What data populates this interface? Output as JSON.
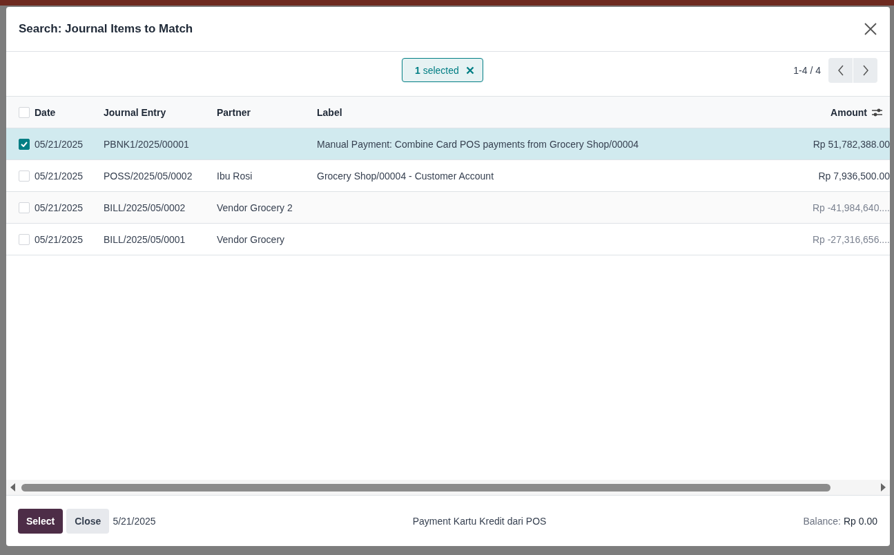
{
  "dialog": {
    "title": "Search: Journal Items to Match"
  },
  "selection": {
    "count": "1",
    "text": "selected"
  },
  "pager": {
    "range": "1-4 / 4"
  },
  "table": {
    "all_selected": false,
    "columns": [
      "Date",
      "Journal Entry",
      "Partner",
      "Label",
      "Amount"
    ],
    "rows": [
      {
        "selected": true,
        "date": "05/21/2025",
        "entry": "PBNK1/2025/00001",
        "partner": "",
        "label": "Manual Payment: Combine Card POS payments from Grocery Shop/00004",
        "amount": "Rp 51,782,388.00",
        "muted": false
      },
      {
        "selected": false,
        "date": "05/21/2025",
        "entry": "POSS/2025/05/0002",
        "partner": "Ibu Rosi",
        "label": "Grocery Shop/00004 - Customer Account",
        "amount": "Rp 7,936,500.00",
        "muted": false
      },
      {
        "selected": false,
        "date": "05/21/2025",
        "entry": "BILL/2025/05/0002",
        "partner": "Vendor Grocery 2",
        "label": "",
        "amount": "Rp -41,984,640....",
        "muted": true
      },
      {
        "selected": false,
        "date": "05/21/2025",
        "entry": "BILL/2025/05/0001",
        "partner": "Vendor Grocery",
        "label": "",
        "amount": "Rp -27,316,656....",
        "muted": true
      }
    ]
  },
  "footer": {
    "buttons": [
      "Select",
      "Close"
    ],
    "date": "5/21/2025",
    "reference": "Payment Kartu Kredit dari POS",
    "balance_label": "Balance:",
    "balance_value": "Rp 0.00"
  }
}
